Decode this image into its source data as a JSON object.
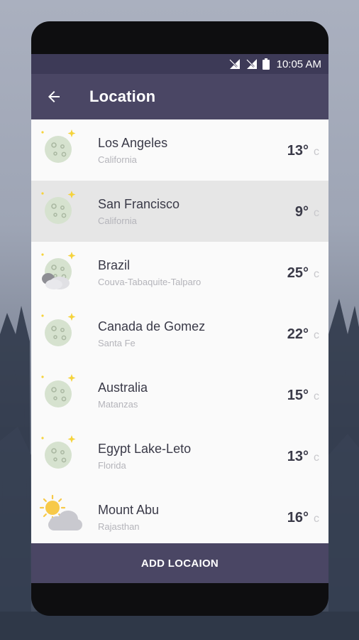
{
  "status": {
    "time": "10:05 AM",
    "icons": [
      "signal-off-icon",
      "signal-off-icon",
      "battery-icon"
    ]
  },
  "appbar": {
    "title": "Location",
    "back_icon": "arrow-left-icon"
  },
  "locations": [
    {
      "city": "Los Angeles",
      "region": "California",
      "temp": "13°",
      "unit": "c",
      "icon": "moon-stars-icon",
      "selected": false
    },
    {
      "city": "San Francisco",
      "region": "California",
      "temp": "9°",
      "unit": "c",
      "icon": "moon-stars-icon",
      "selected": true
    },
    {
      "city": "Brazil",
      "region": "Couva-Tabaquite-Talparo",
      "temp": "25°",
      "unit": "c",
      "icon": "moon-cloud-icon",
      "selected": false
    },
    {
      "city": "Canada de Gomez",
      "region": "Santa Fe",
      "temp": "22°",
      "unit": "c",
      "icon": "moon-stars-icon",
      "selected": false
    },
    {
      "city": "Australia",
      "region": "Matanzas",
      "temp": "15°",
      "unit": "c",
      "icon": "moon-stars-icon",
      "selected": false
    },
    {
      "city": "Egypt Lake-Leto",
      "region": "Florida",
      "temp": "13°",
      "unit": "c",
      "icon": "moon-stars-icon",
      "selected": false
    },
    {
      "city": "Mount Abu",
      "region": "Rajasthan",
      "temp": "16°",
      "unit": "c",
      "icon": "sun-cloud-icon",
      "selected": false
    }
  ],
  "footer": {
    "button_label": "ADD LOCAION"
  },
  "colors": {
    "header": "#4a4664",
    "statusbar": "#3d3a57",
    "selected_row": "#e6e6e6",
    "moon": "#d6e2cf",
    "star": "#f5d33c",
    "sun": "#f7c948"
  }
}
